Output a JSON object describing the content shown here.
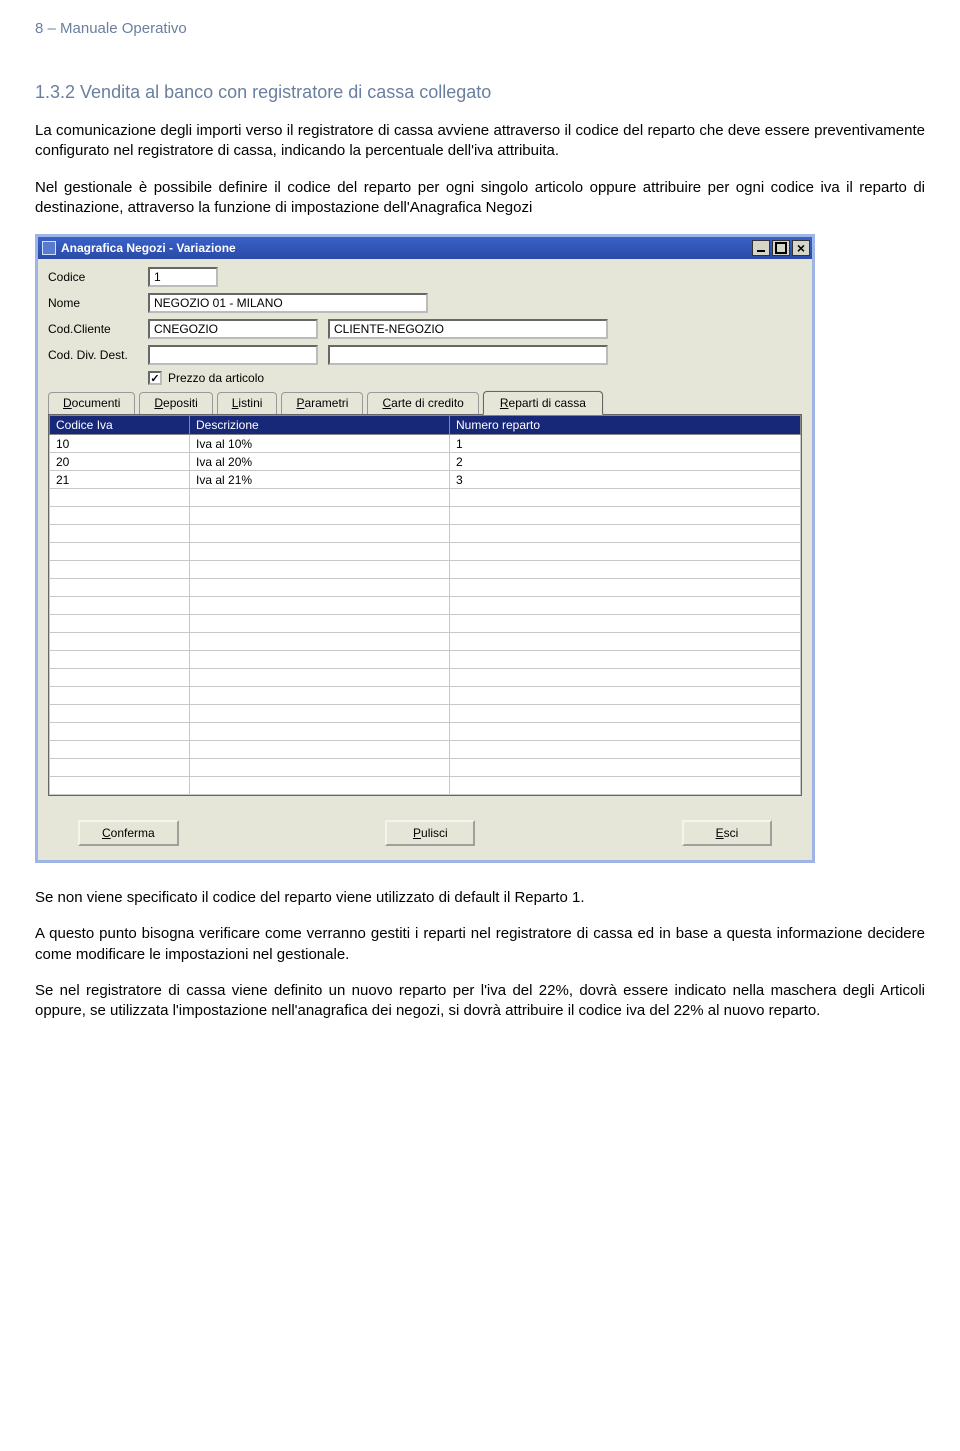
{
  "page_header": "8  –  Manuale Operativo",
  "section_title": "1.3.2 Vendita al banco con registratore di cassa collegato",
  "para1": "La comunicazione degli importi verso il registratore di cassa avviene attraverso il codice del reparto che deve essere preventivamente configurato nel registratore di cassa, indicando la percentuale dell'iva attribuita.",
  "para2": "Nel gestionale è possibile definire il codice del reparto per ogni singolo articolo oppure attribuire per ogni codice iva il reparto di destinazione, attraverso la funzione di impostazione dell'Anagrafica Negozi",
  "window": {
    "title": "Anagrafica Negozi - Variazione",
    "fields": {
      "codice_label": "Codice",
      "codice_value": "1",
      "nome_label": "Nome",
      "nome_value": "NEGOZIO 01 - MILANO",
      "codcliente_label": "Cod.Cliente",
      "codcliente_value": "CNEGOZIO",
      "cliente_desc_value": "CLIENTE-NEGOZIO",
      "coddivdest_label": "Cod. Div. Dest.",
      "coddivdest_value": "",
      "divdest_desc_value": "",
      "checkbox_label": "Prezzo da articolo",
      "checkbox_checked": "✓"
    },
    "tabs": [
      {
        "label_pre": "",
        "ul": "D",
        "label_post": "ocumenti"
      },
      {
        "label_pre": "",
        "ul": "D",
        "label_post": "epositi"
      },
      {
        "label_pre": "",
        "ul": "L",
        "label_post": "istini"
      },
      {
        "label_pre": "",
        "ul": "P",
        "label_post": "arametri"
      },
      {
        "label_pre": "",
        "ul": "C",
        "label_post": "arte di credito"
      },
      {
        "label_pre": "",
        "ul": "R",
        "label_post": "eparti di cassa"
      }
    ],
    "table": {
      "headers": [
        "Codice Iva",
        "Descrizione",
        "Numero reparto"
      ],
      "rows": [
        [
          "10",
          "Iva al 10%",
          "1"
        ],
        [
          "20",
          "Iva al 20%",
          "2"
        ],
        [
          "21",
          "Iva al 21%",
          "3"
        ]
      ],
      "empty_rows": 17
    },
    "buttons": {
      "conferma_ul": "C",
      "conferma_rest": "onferma",
      "pulisci_ul": "P",
      "pulisci_rest": "ulisci",
      "esci_ul": "E",
      "esci_rest": "sci"
    }
  },
  "para3": "Se non viene specificato il codice del reparto viene utilizzato di default il Reparto 1.",
  "para4": "A questo punto bisogna verificare come verranno gestiti i reparti nel registratore di cassa ed in base a questa informazione decidere come modificare le impostazioni nel gestionale.",
  "para5": "Se nel registratore di cassa viene definito un nuovo reparto per l'iva del 22%, dovrà essere indicato nella maschera degli Articoli oppure, se utilizzata l'impostazione nell'anagrafica dei negozi, si dovrà attribuire il codice iva del 22% al nuovo reparto."
}
